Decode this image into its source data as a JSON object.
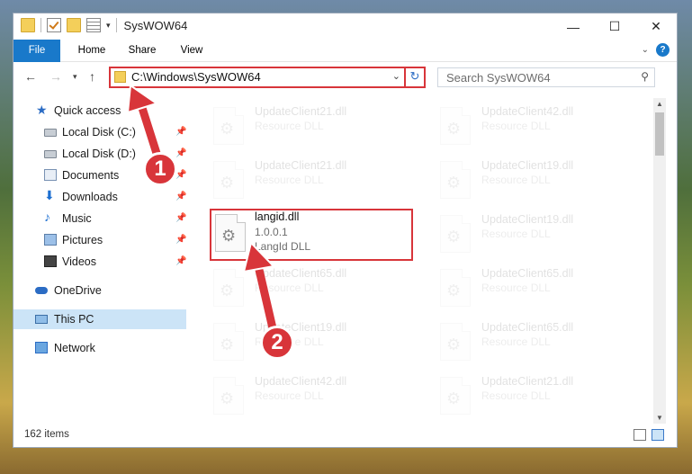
{
  "window": {
    "title": "SysWOW64",
    "minimize_glyph": "—",
    "maximize_glyph": "☐",
    "close_glyph": "✕"
  },
  "ribbon": {
    "tabs": [
      "File",
      "Home",
      "Share",
      "View"
    ],
    "help": "?"
  },
  "address": {
    "path": "C:\\Windows\\SysWOW64",
    "refresh_glyph": "↻"
  },
  "search": {
    "placeholder": "Search SysWOW64"
  },
  "nav_pane": {
    "items": [
      {
        "label": "Quick access",
        "icon": "star-icon",
        "pinned": false
      },
      {
        "label": "Local Disk (C:)",
        "icon": "disk-icon",
        "pinned": true
      },
      {
        "label": "Local Disk (D:)",
        "icon": "disk-icon",
        "pinned": true
      },
      {
        "label": "Documents",
        "icon": "documents-icon",
        "pinned": true
      },
      {
        "label": "Downloads",
        "icon": "downloads-icon",
        "pinned": true
      },
      {
        "label": "Music",
        "icon": "music-icon",
        "pinned": true
      },
      {
        "label": "Pictures",
        "icon": "pictures-icon",
        "pinned": true
      },
      {
        "label": "Videos",
        "icon": "videos-icon",
        "pinned": true
      },
      {
        "label": "OneDrive",
        "icon": "onedrive-icon",
        "pinned": false
      },
      {
        "label": "This PC",
        "icon": "this-pc-icon",
        "pinned": false,
        "selected": true
      },
      {
        "label": "Network",
        "icon": "network-icon",
        "pinned": false
      }
    ]
  },
  "files": {
    "left": [
      {
        "name": "UpdateClient21.dll",
        "line2": "Resource DLL",
        "faded": true
      },
      {
        "name": "UpdateClient21.dll",
        "line2": "Resource DLL",
        "faded": true
      },
      {
        "name": "langid.dll",
        "line2": "1.0.0.1",
        "line3": "LangId DLL",
        "faded": false,
        "highlighted": true
      },
      {
        "name": "UpdateClient65.dll",
        "line2": "Resource DLL",
        "faded": true
      },
      {
        "name": "UpdateClient19.dll",
        "line2": "Resource DLL",
        "faded": true
      },
      {
        "name": "UpdateClient42.dll",
        "line2": "Resource DLL",
        "faded": true
      }
    ],
    "right": [
      {
        "name": "UpdateClient42.dll",
        "line2": "Resource DLL",
        "faded": true
      },
      {
        "name": "UpdateClient19.dll",
        "line2": "Resource DLL",
        "faded": true
      },
      {
        "name": "UpdateClient19.dll",
        "line2": "Resource DLL",
        "faded": true
      },
      {
        "name": "UpdateClient65.dll",
        "line2": "Resource DLL",
        "faded": true
      },
      {
        "name": "UpdateClient65.dll",
        "line2": "Resource DLL",
        "faded": true
      },
      {
        "name": "UpdateClient21.dll",
        "line2": "Resource DLL",
        "faded": true
      }
    ]
  },
  "status": {
    "item_count": "162 items"
  },
  "annotations": {
    "badge1": "1",
    "badge2": "2",
    "color": "#d8353a"
  }
}
